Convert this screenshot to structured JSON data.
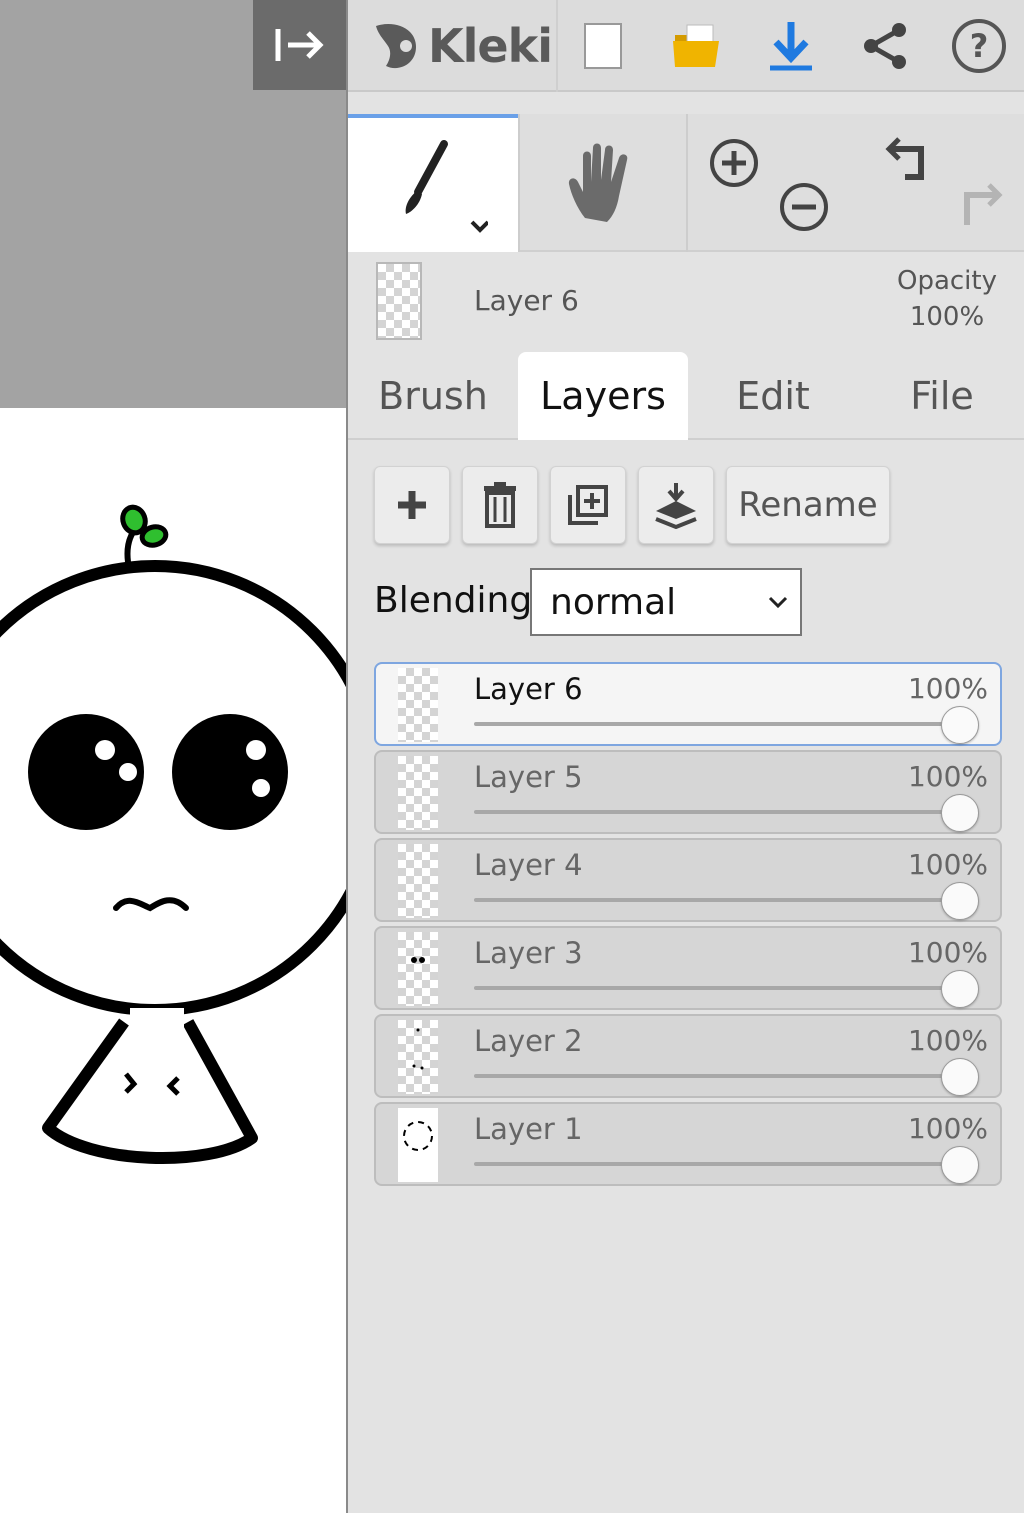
{
  "app": {
    "name": "Kleki"
  },
  "current_layer": {
    "name": "Layer 6",
    "opacity_label": "Opacity",
    "opacity_value": "100%"
  },
  "tabs": [
    {
      "label": "Brush"
    },
    {
      "label": "Layers"
    },
    {
      "label": "Edit"
    },
    {
      "label": "File"
    }
  ],
  "active_tab": "Layers",
  "actions": {
    "rename_label": "Rename"
  },
  "blending": {
    "label": "Blending",
    "value": "normal"
  },
  "layers": [
    {
      "name": "Layer 6",
      "opacity": "100%",
      "opacity_fraction": 1.0,
      "selected": true
    },
    {
      "name": "Layer 5",
      "opacity": "100%",
      "opacity_fraction": 1.0,
      "selected": false
    },
    {
      "name": "Layer 4",
      "opacity": "100%",
      "opacity_fraction": 1.0,
      "selected": false
    },
    {
      "name": "Layer 3",
      "opacity": "100%",
      "opacity_fraction": 1.0,
      "selected": false
    },
    {
      "name": "Layer 2",
      "opacity": "100%",
      "opacity_fraction": 1.0,
      "selected": false
    },
    {
      "name": "Layer 1",
      "opacity": "100%",
      "opacity_fraction": 1.0,
      "selected": false
    }
  ],
  "colors": {
    "accent_blue": "#1f7ae0",
    "folder_yellow": "#f0b400",
    "sprout_green": "#2fbf2f",
    "panel_bg": "#e3e3e3",
    "canvas_gray": "#a3a3a3"
  },
  "icons": {
    "collapse": "collapse-panel-icon",
    "new": "new-image-icon",
    "open": "open-folder-icon",
    "save": "download-icon",
    "share": "share-icon",
    "help": "help-icon",
    "brush": "brush-icon",
    "hand": "hand-icon",
    "zoom_in": "zoom-in-icon",
    "zoom_out": "zoom-out-icon",
    "undo": "undo-icon",
    "redo": "redo-icon"
  }
}
